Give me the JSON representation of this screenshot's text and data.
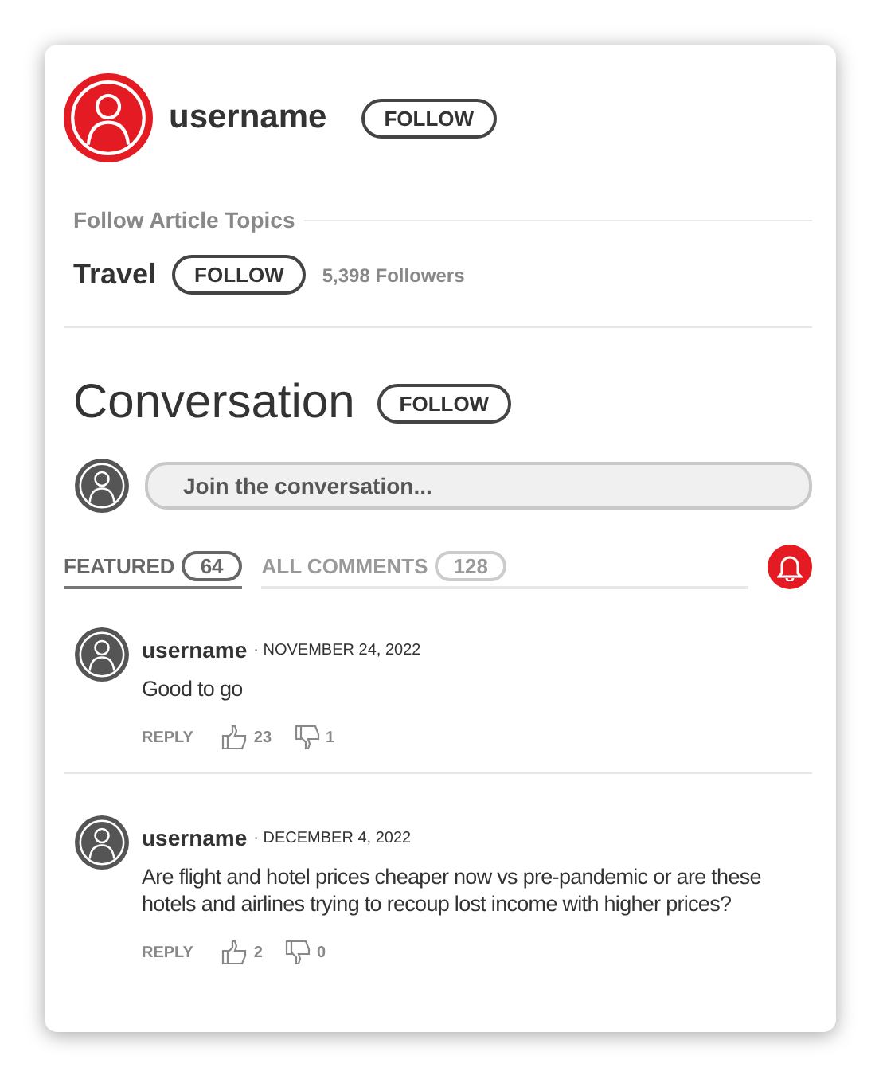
{
  "author": {
    "name": "username",
    "follow": "FOLLOW"
  },
  "topics": {
    "heading": "Follow Article Topics",
    "items": [
      {
        "name": "Travel",
        "follow": "FOLLOW",
        "followers": "5,398 Followers"
      }
    ]
  },
  "conversation": {
    "title": "Conversation",
    "follow": "FOLLOW",
    "placeholder": "Join the conversation..."
  },
  "tabs": [
    {
      "label": "FEATURED",
      "count": "64",
      "selected": true
    },
    {
      "label": "ALL COMMENTS",
      "count": "128",
      "selected": false
    }
  ],
  "comments": [
    {
      "user": "username",
      "date": "· NOVEMBER 24, 2022",
      "text": "Good to go",
      "reply": "REPLY",
      "likes": "23",
      "dislikes": "1"
    },
    {
      "user": "username",
      "date": "· DECEMBER 4, 2022",
      "text": "Are flight and hotel prices cheaper now vs pre-pandemic or are these hotels and airlines trying to recoup lost income with higher prices?",
      "reply": "REPLY",
      "likes": "2",
      "dislikes": "0"
    }
  ]
}
